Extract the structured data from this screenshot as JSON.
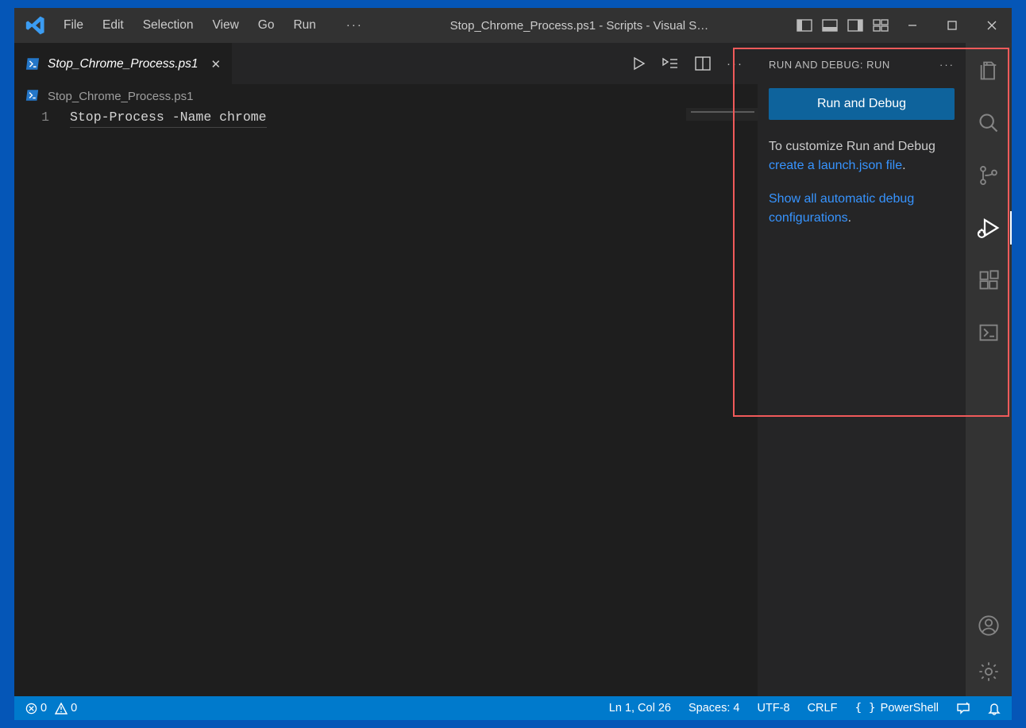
{
  "menu": {
    "items": [
      "File",
      "Edit",
      "Selection",
      "View",
      "Go",
      "Run"
    ]
  },
  "title": "Stop_Chrome_Process.ps1 - Scripts - Visual S…",
  "tab": {
    "name": "Stop_Chrome_Process.ps1"
  },
  "breadcrumb": {
    "file": "Stop_Chrome_Process.ps1"
  },
  "editor": {
    "line_no": "1",
    "code": "Stop-Process -Name chrome"
  },
  "sidepanel": {
    "header": "RUN AND DEBUG: RUN",
    "button": "Run and Debug",
    "text_prefix": "To customize Run and Debug ",
    "link1": "create a launch.json file",
    "link2": "Show all automatic debug configurations"
  },
  "statusbar": {
    "errors": "0",
    "warnings": "0",
    "ln_col": "Ln 1, Col 26",
    "spaces": "Spaces: 4",
    "encoding": "UTF-8",
    "eol": "CRLF",
    "lang": "PowerShell"
  },
  "icons": {
    "ps": "〉_",
    "more": "···"
  }
}
